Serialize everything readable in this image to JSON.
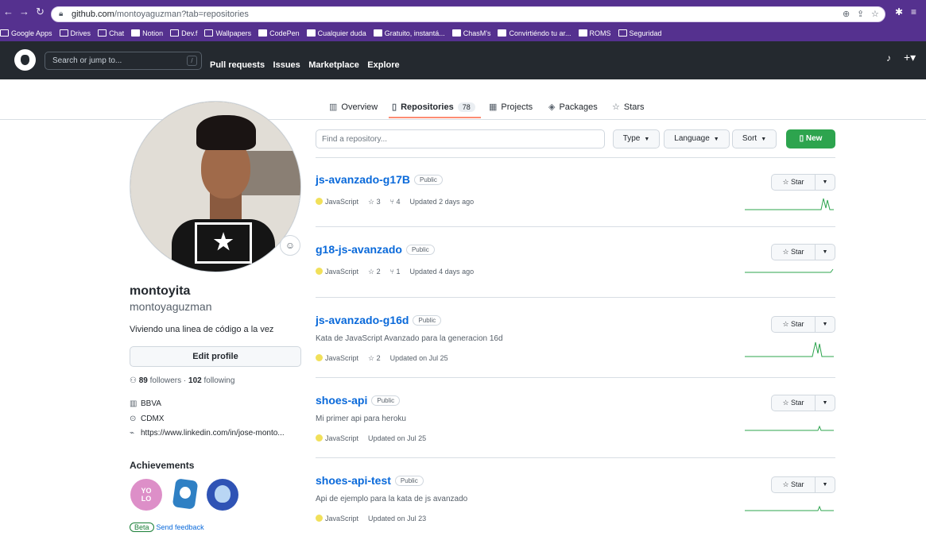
{
  "browser": {
    "url_host": "github.com",
    "url_path": "/montoyaguzman?tab=repositories",
    "bookmarks": [
      {
        "label": "Google Apps",
        "icon": "folder-icon"
      },
      {
        "label": "Drives",
        "icon": "folder-icon"
      },
      {
        "label": "Chat",
        "icon": "folder-icon"
      },
      {
        "label": "Notion",
        "icon": "notion-icon"
      },
      {
        "label": "Dev.f",
        "icon": "folder-icon"
      },
      {
        "label": "Wallpapers",
        "icon": "folder-icon"
      },
      {
        "label": "CodePen",
        "icon": "codepen-icon"
      },
      {
        "label": "Cualquier duda",
        "icon": "site-icon"
      },
      {
        "label": "Gratuito, instantá...",
        "icon": "site-icon"
      },
      {
        "label": "ChasM's",
        "icon": "site-icon"
      },
      {
        "label": "Convirtiéndo tu ar...",
        "icon": "site-icon"
      },
      {
        "label": "ROMS",
        "icon": "site-icon"
      },
      {
        "label": "Seguridad",
        "icon": "folder-icon"
      }
    ]
  },
  "header": {
    "search_placeholder": "Search or jump to...",
    "slash_key": "/",
    "nav": [
      "Pull requests",
      "Issues",
      "Marketplace",
      "Explore"
    ]
  },
  "tabs": {
    "overview": "Overview",
    "repositories": "Repositories",
    "repositories_count": "78",
    "projects": "Projects",
    "packages": "Packages",
    "stars": "Stars"
  },
  "profile": {
    "display_name": "montoyita",
    "username": "montoyaguzman",
    "bio": "Viviendo una linea de código a la vez",
    "edit_label": "Edit profile",
    "followers_count": "89",
    "followers_label": "followers",
    "separator": "·",
    "following_count": "102",
    "following_label": "following",
    "company": "BBVA",
    "location": "CDMX",
    "website": "https://www.linkedin.com/in/jose-monto...",
    "achievements_title": "Achievements",
    "beta_label": "Beta",
    "feedback_label": "Send feedback"
  },
  "repo_toolbar": {
    "find_placeholder": "Find a repository...",
    "type_label": "Type",
    "language_label": "Language",
    "sort_label": "Sort",
    "new_label": "New"
  },
  "repos": [
    {
      "name": "js-avanzado-g17B",
      "visibility": "Public",
      "description": "",
      "language": "JavaScript",
      "stars": "3",
      "forks": "4",
      "updated": "Updated 2 days ago"
    },
    {
      "name": "g18-js-avanzado",
      "visibility": "Public",
      "description": "",
      "language": "JavaScript",
      "stars": "2",
      "forks": "1",
      "updated": "Updated 4 days ago"
    },
    {
      "name": "js-avanzado-g16d",
      "visibility": "Public",
      "description": "Kata de JavaScript Avanzado para la generacion 16d",
      "language": "JavaScript",
      "stars": "2",
      "forks": "",
      "updated": "Updated on Jul 25"
    },
    {
      "name": "shoes-api",
      "visibility": "Public",
      "description": "Mi primer api para heroku",
      "language": "JavaScript",
      "stars": "",
      "forks": "",
      "updated": "Updated on Jul 25"
    },
    {
      "name": "shoes-api-test",
      "visibility": "Public",
      "description": "Api de ejemplo para la kata de js avanzado",
      "language": "JavaScript",
      "stars": "",
      "forks": "",
      "updated": "Updated on Jul 23"
    }
  ],
  "star_label": "Star",
  "colors": {
    "browser_frame": "#55318f",
    "github_header": "#24292f",
    "link_blue": "#0969da",
    "new_button_green": "#2da44e",
    "tab_underline": "#fd8c73",
    "javascript_dot": "#f1e05a"
  }
}
